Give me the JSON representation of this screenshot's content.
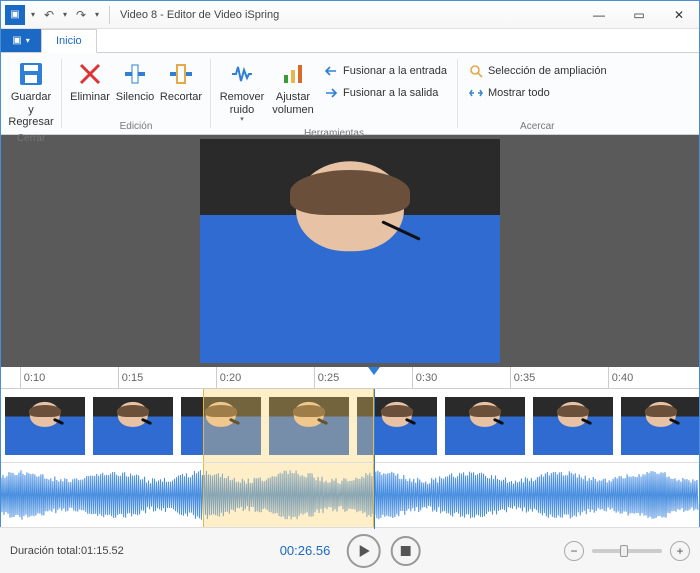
{
  "window": {
    "title": "Video 8 - Editor de Video iSpring"
  },
  "qa": {
    "file_menu_glyph": "▣",
    "dropdown_glyph": "▾",
    "undo_glyph": "↶",
    "redo_glyph": "↷"
  },
  "tabs": {
    "file_dropdown": "▾",
    "home": "Inicio"
  },
  "ribbon": {
    "close": {
      "save_return": "Guardar y\nRegresar",
      "label": "Cerrar"
    },
    "edit": {
      "delete": "Eliminar",
      "silence": "Silencio",
      "crop": "Recortar",
      "label": "Edición"
    },
    "tools": {
      "remove_noise": "Remover\nruido",
      "adjust_volume": "Ajustar\nvolumen",
      "merge_in": "Fusionar a la entrada",
      "merge_out": "Fusionar a la salida",
      "label": "Herramientas"
    },
    "zoom": {
      "zoom_selection": "Selección de ampliación",
      "show_all": "Mostrar todo",
      "label": "Acercar"
    }
  },
  "ruler": {
    "ticks": [
      "0:10",
      "0:15",
      "0:20",
      "0:25",
      "0:30",
      "0:35",
      "0:40"
    ]
  },
  "timeline": {
    "selection_start_pct": 29,
    "selection_end_pct": 53.5,
    "playhead_pct": 53.5
  },
  "playback": {
    "current_time": "00:26.56",
    "total_duration_label": "Duración total:",
    "total_duration_value": "01:15.52"
  },
  "glyphs": {
    "minimize": "—",
    "maximize": "▭",
    "close": "✕",
    "play": "▶",
    "stop": "■",
    "minus": "−",
    "plus": "+",
    "scroll_left": "◀",
    "scroll_right": "▶"
  }
}
